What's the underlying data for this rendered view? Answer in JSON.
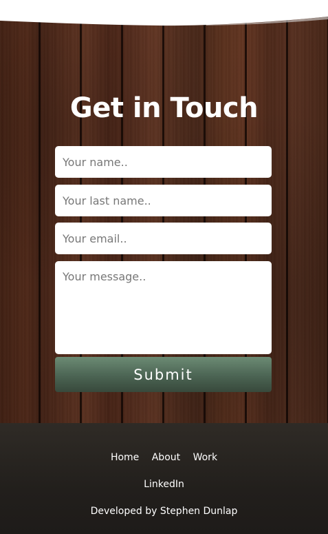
{
  "contact": {
    "title": "Get in Touch",
    "fields": {
      "name_placeholder": "Your name..",
      "last_name_placeholder": "Your last name..",
      "email_placeholder": "Your email..",
      "message_placeholder": "Your message.."
    },
    "submit_label": "Submit"
  },
  "footer": {
    "nav": {
      "home": "Home",
      "about": "About",
      "work": "Work"
    },
    "linkedin": "LinkedIn",
    "credit": "Developed by Stephen Dunlap"
  },
  "colors": {
    "submit_button": "#4b6453",
    "footer_background": "#2a2622",
    "wood_background": "#5a2e1c"
  }
}
